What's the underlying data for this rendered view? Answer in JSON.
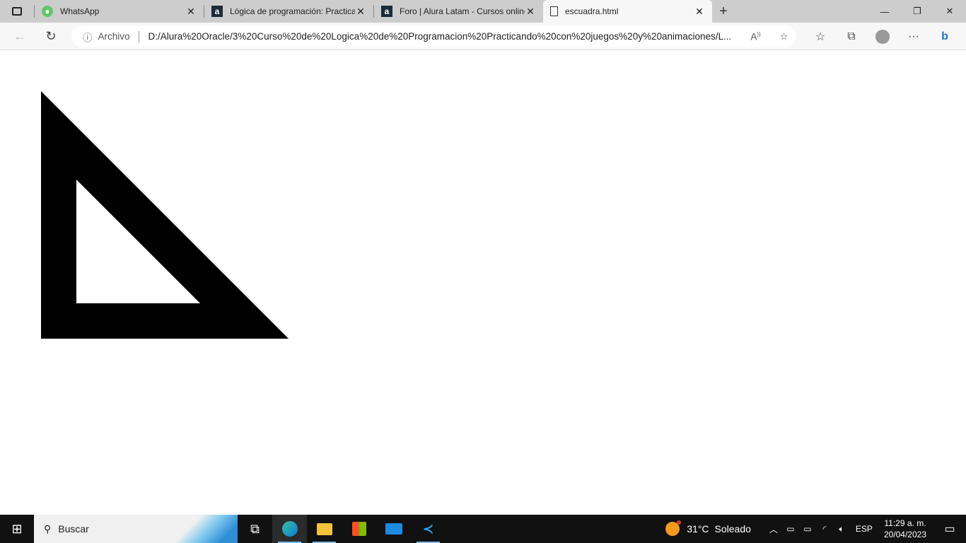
{
  "tabs": [
    {
      "title": "WhatsApp",
      "icon": "whatsapp-icon",
      "active": false
    },
    {
      "title": "Lógica de programación: Practicando con juegos y animaciones",
      "icon": "alura-icon",
      "active": false
    },
    {
      "title": "Foro | Alura Latam - Cursos online",
      "icon": "alura-icon",
      "active": false
    },
    {
      "title": "escuadra.html",
      "icon": "file-icon",
      "active": true
    }
  ],
  "address": {
    "label": "Archivo",
    "url": "D:/Alura%20Oracle/3%20Curso%20de%20Logica%20de%20Programacion%20Practicando%20con%20juegos%20y%20animaciones/L..."
  },
  "canvas": {
    "fill": "#000000"
  },
  "taskbar": {
    "search_placeholder": "Buscar",
    "weather_temp": "31°C",
    "weather_text": "Soleado",
    "lang": "ESP",
    "time": "11:29 a. m.",
    "date": "20/04/2023"
  }
}
